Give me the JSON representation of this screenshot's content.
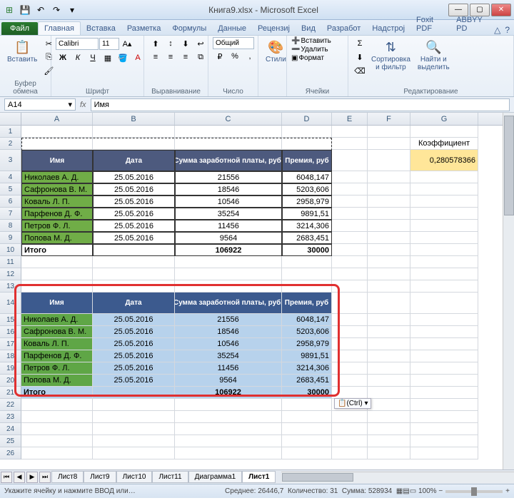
{
  "title": "Книга9.xlsx - Microsoft Excel",
  "tabs": {
    "file": "Файл",
    "list": [
      "Главная",
      "Вставка",
      "Разметка",
      "Формулы",
      "Данные",
      "Рецензиј",
      "Вид",
      "Разработ",
      "Надстрој",
      "Foxit PDF",
      "ABBYY PD"
    ],
    "active_index": 0
  },
  "ribbon": {
    "clipboard": {
      "paste": "Вставить",
      "label": "Буфер обмена"
    },
    "font": {
      "family": "Calibri",
      "size": "11",
      "label": "Шрифт"
    },
    "align": {
      "label": "Выравнивание"
    },
    "number": {
      "format": "Общий",
      "label": "Число"
    },
    "styles": {
      "btn": "Стили"
    },
    "cells": {
      "insert": "Вставить",
      "delete": "Удалить",
      "format": "Формат",
      "label": "Ячейки"
    },
    "editing": {
      "sort": "Сортировка\nи фильтр",
      "find": "Найти и\nвыделить",
      "label": "Редактирование"
    }
  },
  "namebox": "A14",
  "formula": "Имя",
  "colheads": [
    "A",
    "B",
    "C",
    "D",
    "E",
    "F",
    "G"
  ],
  "rows": [
    1,
    2,
    3,
    4,
    5,
    6,
    7,
    8,
    9,
    10,
    11,
    12,
    13,
    14,
    15,
    16,
    17,
    18,
    19,
    20,
    21,
    22,
    23,
    24,
    25,
    26
  ],
  "table": {
    "headers": [
      "Имя",
      "Дата",
      "Сумма заработной платы, руб.",
      "Премия, руб"
    ],
    "data": [
      [
        "Николаев А. Д.",
        "25.05.2016",
        "21556",
        "6048,147"
      ],
      [
        "Сафронова В. М.",
        "25.05.2016",
        "18546",
        "5203,606"
      ],
      [
        "Коваль Л. П.",
        "25.05.2016",
        "10546",
        "2958,979"
      ],
      [
        "Парфенов Д. Ф.",
        "25.05.2016",
        "35254",
        "9891,51"
      ],
      [
        "Петров Ф. Л.",
        "25.05.2016",
        "11456",
        "3214,306"
      ],
      [
        "Попова М. Д.",
        "25.05.2016",
        "9564",
        "2683,451"
      ]
    ],
    "total_label": "Итого",
    "total_sum": "106922",
    "total_bonus": "30000"
  },
  "coef": {
    "label": "Коэффициент",
    "value": "0,280578366"
  },
  "paste_options": "(Ctrl) ▾",
  "sheets": {
    "list": [
      "Лист8",
      "Лист9",
      "Лист10",
      "Лист11",
      "Диаграмма1",
      "Лист1"
    ],
    "active_index": 5
  },
  "status": {
    "prompt": "Укажите ячейку и нажмите ВВОД или…",
    "avg_label": "Среднее:",
    "avg": "26446,7",
    "count_label": "Количество:",
    "count": "31",
    "sum_label": "Сумма:",
    "sum": "528934",
    "zoom": "100%"
  }
}
